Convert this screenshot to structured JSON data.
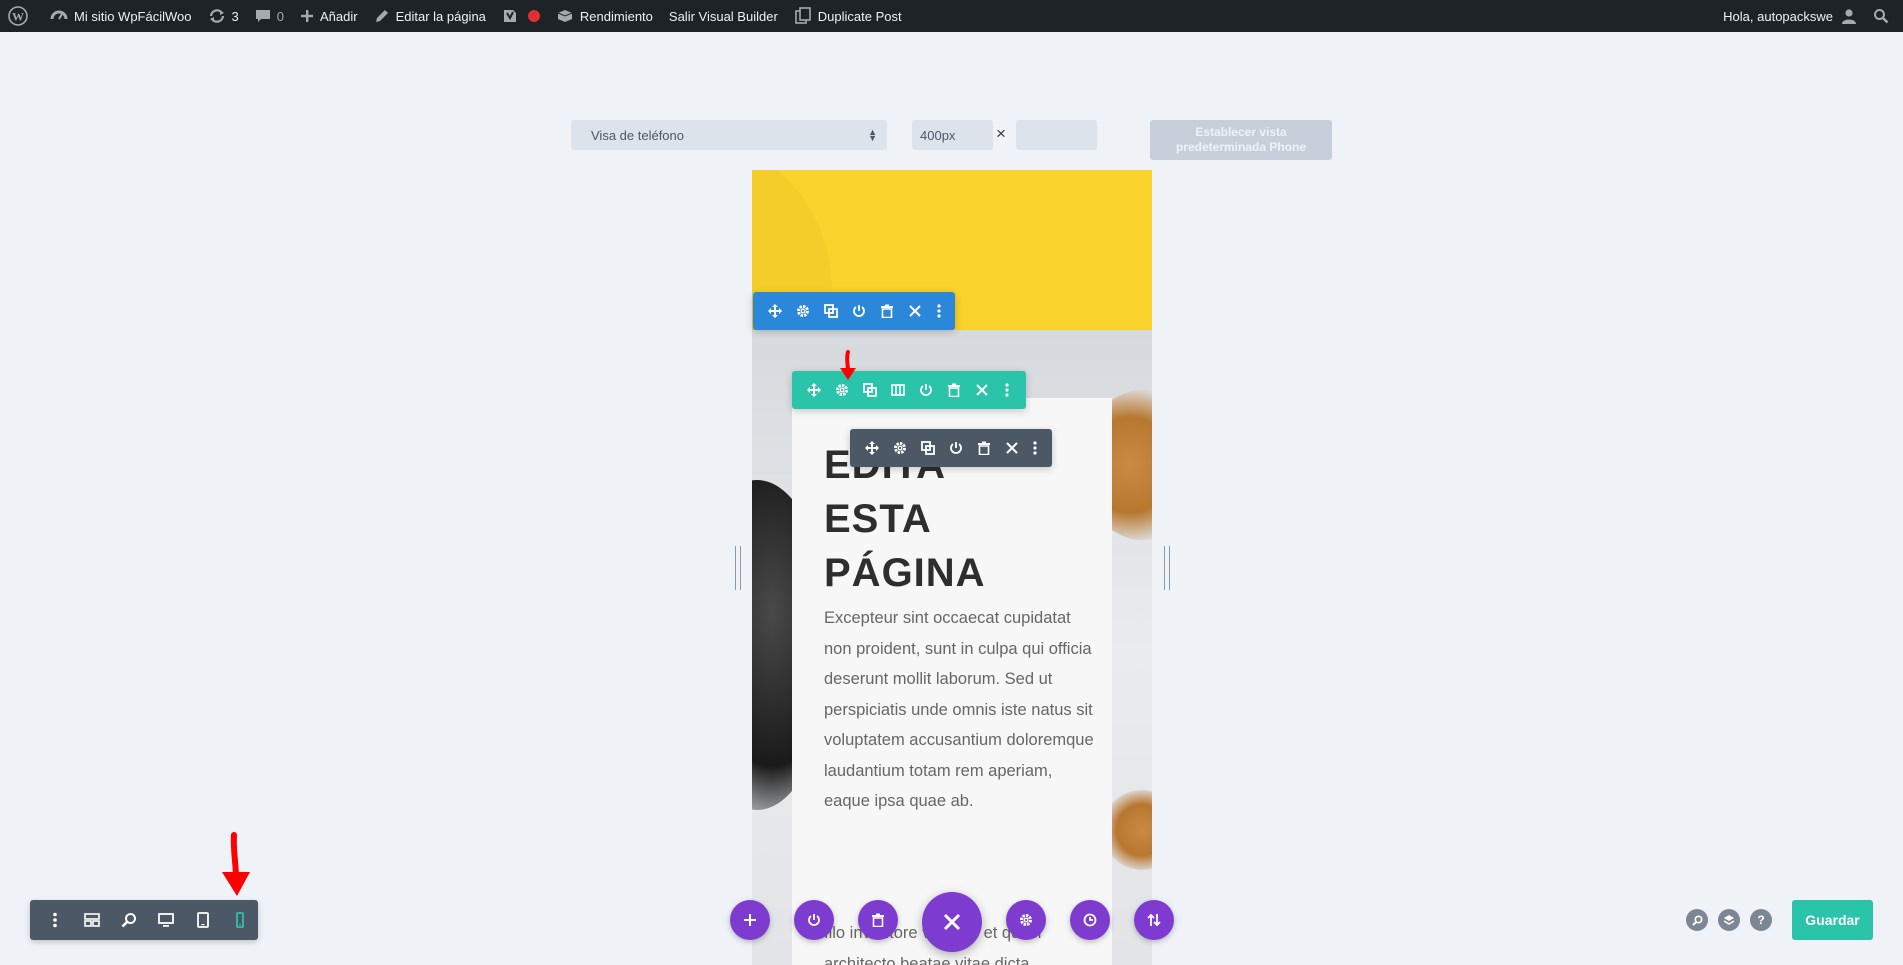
{
  "admin_bar": {
    "site_name": "Mi sitio WpFácilWoo",
    "updates_count": "3",
    "comments_count": "0",
    "add_new": "Añadir",
    "edit_page": "Editar la página",
    "performance": "Rendimiento",
    "exit_builder": "Salir Visual Builder",
    "duplicate_post": "Duplicate Post",
    "greeting": "Hola, autopackswe"
  },
  "preview_controls": {
    "device_select_value": "Visa de teléfono",
    "width_value": "400px",
    "times_symbol": "×",
    "height_value": "",
    "default_view_button": "Establecer vista predeterminada Phone"
  },
  "page_content": {
    "heading_lines": [
      "EDITA",
      "ESTA",
      "PÁGINA"
    ],
    "body_text": "Excepteur sint occaecat cupidatat non proident, sunt in culpa qui officia deserunt mollit laborum. Sed ut perspiciatis unde omnis iste natus sit voluptatem accusantium doloremque laudantium totam rem aperiam, eaque ipsa quae ab.",
    "body_text_2": "Illo inventore veritatis et quasi architecto beatae vitae dicta"
  },
  "colors": {
    "section_toolbar": "#2b87da",
    "row_toolbar": "#29c4a9",
    "module_toolbar": "#4c5866",
    "builder_purple": "#7e3bd0",
    "save_green": "#29c4a9",
    "hero_yellow": "#f9d22b",
    "annotation_red": "#ff0000"
  },
  "icons": {
    "section_toolbar": [
      "move-icon",
      "gear-icon",
      "duplicate-icon",
      "power-icon",
      "trash-icon",
      "close-icon",
      "more-icon"
    ],
    "row_toolbar": [
      "move-icon",
      "gear-icon",
      "duplicate-icon",
      "columns-icon",
      "power-icon",
      "trash-icon",
      "close-icon",
      "more-icon"
    ],
    "module_toolbar": [
      "move-icon",
      "gear-icon",
      "duplicate-icon",
      "power-icon",
      "trash-icon",
      "close-icon",
      "more-icon"
    ],
    "settings_bar": [
      "more-icon",
      "layout-icon",
      "zoom-icon",
      "desktop-icon",
      "tablet-icon",
      "phone-icon"
    ],
    "bottom_center": [
      "add-icon",
      "power-icon",
      "trash-icon",
      "close-icon",
      "gear-icon",
      "history-icon",
      "portability-icon"
    ],
    "bottom_right": [
      "search-icon",
      "layers-icon",
      "help-icon"
    ]
  },
  "footer": {
    "save_button": "Guardar",
    "help_symbol": "?"
  }
}
